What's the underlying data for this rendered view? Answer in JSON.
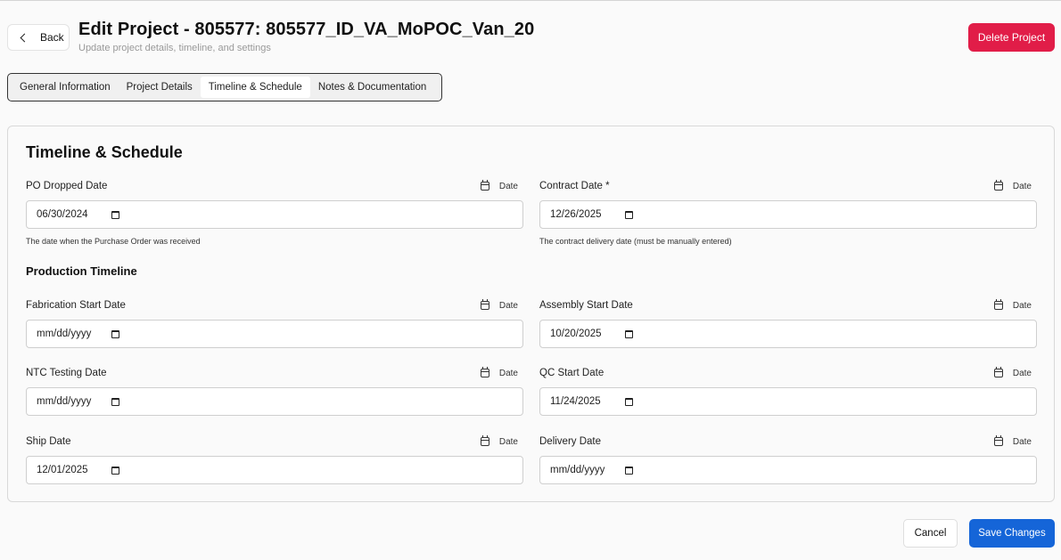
{
  "header": {
    "back_label": "Back",
    "title": "Edit Project - 805577: 805577_ID_VA_MoPOC_Van_20",
    "subtitle": "Update project details, timeline, and settings",
    "delete_label": "Delete Project"
  },
  "tabs": [
    {
      "label": "General Information",
      "active": false
    },
    {
      "label": "Project Details",
      "active": false
    },
    {
      "label": "Timeline & Schedule",
      "active": true
    },
    {
      "label": "Notes & Documentation",
      "active": false
    }
  ],
  "section": {
    "title": "Timeline & Schedule",
    "production_title": "Production Timeline"
  },
  "fields": {
    "po_dropped": {
      "label": "PO Dropped Date",
      "tag": "Date",
      "value": "06/30/2024",
      "help": "The date when the Purchase Order was received"
    },
    "contract": {
      "label": "Contract Date *",
      "tag": "Date",
      "value": "12/26/2025",
      "help": "The contract delivery date (must be manually entered)"
    },
    "fabrication_start": {
      "label": "Fabrication Start Date",
      "tag": "Date",
      "value": "mm/dd/yyyy"
    },
    "assembly_start": {
      "label": "Assembly Start Date",
      "tag": "Date",
      "value": "10/20/2025"
    },
    "ntc_testing": {
      "label": "NTC Testing Date",
      "tag": "Date",
      "value": "mm/dd/yyyy"
    },
    "qc_start": {
      "label": "QC Start Date",
      "tag": "Date",
      "value": "11/24/2025"
    },
    "ship": {
      "label": "Ship Date",
      "tag": "Date",
      "value": "12/01/2025"
    },
    "delivery": {
      "label": "Delivery Date",
      "tag": "Date",
      "value": "mm/dd/yyyy"
    }
  },
  "footer": {
    "cancel_label": "Cancel",
    "save_label": "Save Changes"
  },
  "colors": {
    "delete": "#e11d48",
    "save": "#1565d8"
  }
}
